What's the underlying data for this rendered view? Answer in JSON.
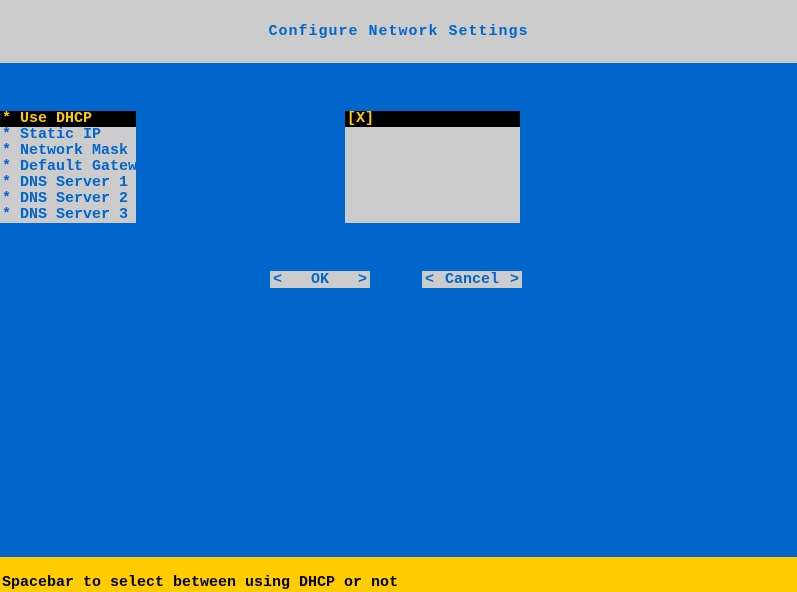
{
  "header": {
    "title": "Configure Network Settings"
  },
  "settings": {
    "items": [
      {
        "label": "Use DHCP",
        "selected": true
      },
      {
        "label": "Static IP",
        "selected": false
      },
      {
        "label": "Network Mask",
        "selected": false
      },
      {
        "label": "Default Gateway",
        "selected": false
      },
      {
        "label": "DNS Server 1",
        "selected": false
      },
      {
        "label": "DNS Server 2",
        "selected": false
      },
      {
        "label": "DNS Server 3",
        "selected": false
      }
    ]
  },
  "values": {
    "items": [
      {
        "label": "[X]",
        "selected": true
      },
      {
        "label": "",
        "selected": false
      },
      {
        "label": "",
        "selected": false
      },
      {
        "label": "",
        "selected": false
      },
      {
        "label": "",
        "selected": false
      },
      {
        "label": "",
        "selected": false
      },
      {
        "label": "",
        "selected": false
      }
    ]
  },
  "buttons": {
    "ok": "OK",
    "cancel": "Cancel"
  },
  "footer": {
    "hint": "Spacebar to select between using DHCP or not"
  }
}
